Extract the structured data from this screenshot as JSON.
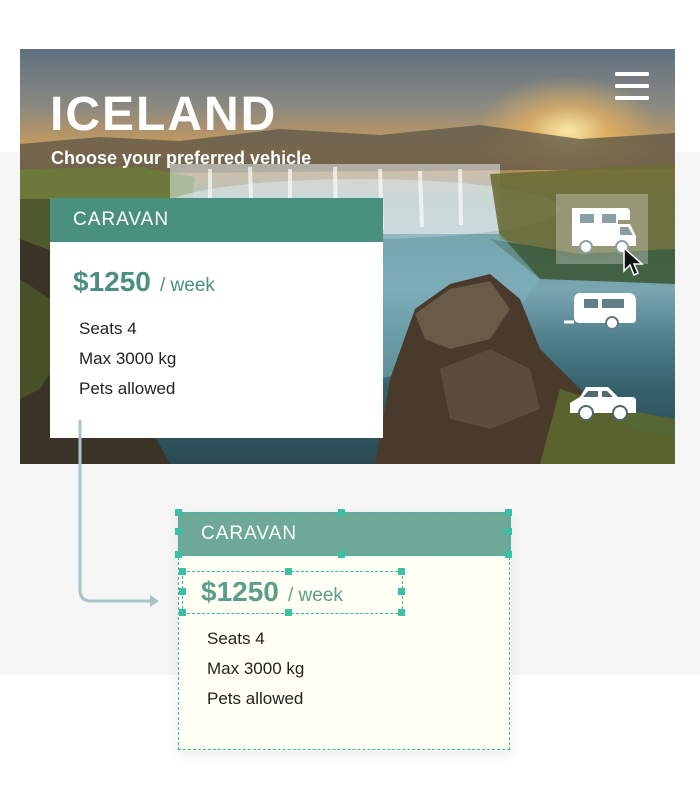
{
  "hero": {
    "title": "ICELAND",
    "subtitle": "Choose your preferred vehicle"
  },
  "menu": {
    "icon": "hamburger-menu-icon"
  },
  "vehicles": [
    {
      "icon": "camper-van-icon",
      "selected": true
    },
    {
      "icon": "caravan-trailer-icon",
      "selected": false
    },
    {
      "icon": "car-icon",
      "selected": false
    }
  ],
  "card": {
    "title": "CARAVAN",
    "price": "$1250",
    "period": "/ week",
    "features": [
      "Seats 4",
      "Max 3000 kg",
      "Pets allowed"
    ]
  },
  "colors": {
    "accent": "#4a907e",
    "accent_light": "#6ea896",
    "selection": "#3fb7a3",
    "card_highlight": "#fffff3"
  }
}
